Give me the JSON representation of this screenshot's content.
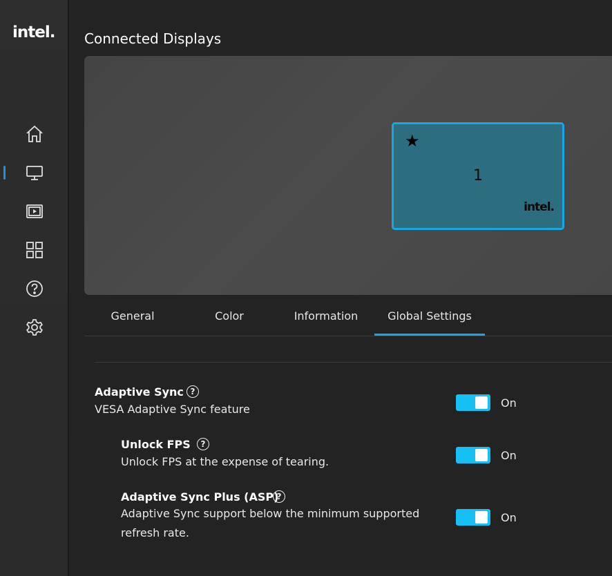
{
  "brand": {
    "logo_text": "intel."
  },
  "sidebar": {
    "items": [
      {
        "name": "home",
        "icon": "home-icon"
      },
      {
        "name": "display",
        "icon": "monitor-icon",
        "active": true
      },
      {
        "name": "video",
        "icon": "video-icon"
      },
      {
        "name": "apps",
        "icon": "grid-icon"
      },
      {
        "name": "help",
        "icon": "help-icon"
      },
      {
        "name": "settings",
        "icon": "gear-icon"
      }
    ],
    "accent_color": "#1e90e6"
  },
  "page": {
    "title": "Connected Displays"
  },
  "display": {
    "number": "1",
    "primary_marker": "★",
    "brand": "intel."
  },
  "tabs": [
    {
      "label": "General"
    },
    {
      "label": "Color"
    },
    {
      "label": "Information"
    },
    {
      "label": "Global Settings",
      "active": true
    }
  ],
  "settings": [
    {
      "title": "Adaptive Sync",
      "desc": "VESA Adaptive Sync feature",
      "state": "On"
    },
    {
      "title": "Unlock FPS",
      "desc": "Unlock FPS at the expense of tearing.",
      "state": "On"
    },
    {
      "title": "Adaptive Sync Plus (ASP)",
      "desc_line1": "Adaptive Sync support below the minimum supported",
      "desc_line2": "refresh rate.",
      "state": "On"
    }
  ],
  "help_glyph": "?",
  "colors": {
    "toggle_on": "#16c0f5",
    "tab_underline": "#1aa7e0",
    "monitor_fill": "#2c6d80"
  }
}
